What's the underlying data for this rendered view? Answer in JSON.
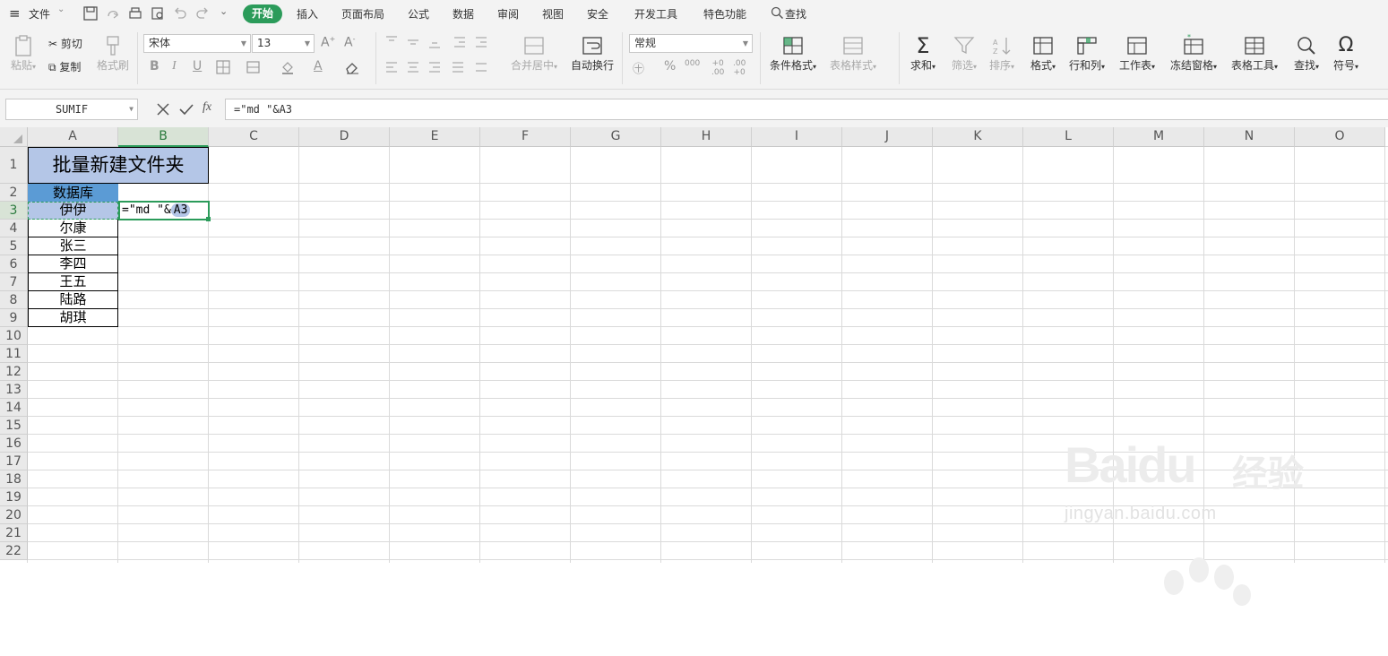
{
  "menu": {
    "file": "文件",
    "tabs": [
      "开始",
      "插入",
      "页面布局",
      "公式",
      "数据",
      "审阅",
      "视图",
      "安全",
      "开发工具",
      "特色功能"
    ],
    "search": "查找"
  },
  "ribbon": {
    "paste": "粘贴",
    "cut": "剪切",
    "copy": "复制",
    "format_painter": "格式刷",
    "font_name": "宋体",
    "font_size": "13",
    "merge_center": "合并居中",
    "wrap_text": "自动换行",
    "number_format": "常规",
    "conditional_format": "条件格式",
    "table_style": "表格样式",
    "sum": "求和",
    "filter": "筛选",
    "sort": "排序",
    "format": "格式",
    "row_col": "行和列",
    "worksheet": "工作表",
    "freeze": "冻结窗格",
    "table_tools": "表格工具",
    "find": "查找",
    "symbol": "符号"
  },
  "formula_bar": {
    "name_box": "SUMIF",
    "formula": "=\"md \"&A3"
  },
  "columns": [
    "A",
    "B",
    "C",
    "D",
    "E",
    "F",
    "G",
    "H",
    "I",
    "J",
    "K",
    "L",
    "M",
    "N",
    "O"
  ],
  "rows": [
    "1",
    "2",
    "3",
    "4",
    "5",
    "6",
    "7",
    "8",
    "9",
    "10",
    "11",
    "12",
    "13",
    "14",
    "15",
    "16",
    "17",
    "18",
    "19",
    "20",
    "21",
    "22"
  ],
  "sheet": {
    "title": "批量新建文件夹",
    "header": "数据库",
    "names": [
      "伊伊",
      "尔康",
      "张三",
      "李四",
      "王五",
      "陆路",
      "胡琪"
    ],
    "b3_formula_prefix": "=\"md \"&",
    "b3_ref": "A3"
  },
  "watermark": {
    "brand": "Baidu",
    "cn": "经验",
    "url": "jingyan.baidu.com"
  },
  "colors": {
    "accent": "#2b9b5a",
    "title_fill": "#b4c6e7",
    "header_fill": "#5b9bd5",
    "selected_fill": "#b4c6e7"
  }
}
